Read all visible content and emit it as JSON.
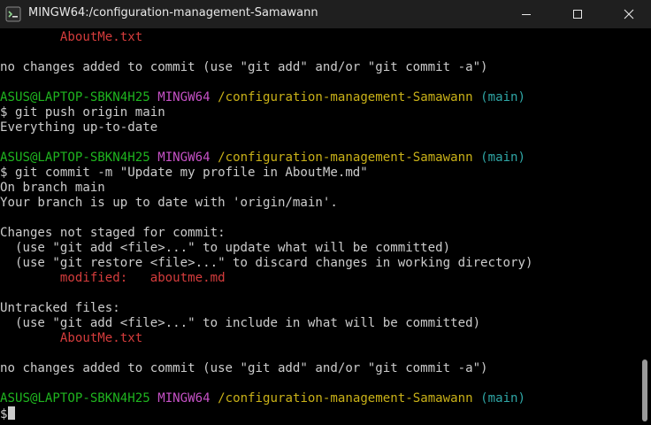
{
  "window": {
    "title": "MINGW64:/configuration-management-Samawann",
    "controls": {
      "minimize_icon": "minimize-icon",
      "maximize_icon": "maximize-icon",
      "close_icon": "close-icon"
    }
  },
  "terminal": {
    "prompt": {
      "user_host": "ASUS@LAPTOP-SBKN4H25",
      "shell": "MINGW64",
      "path": "/configuration-management-Samawann",
      "branch": "(main)",
      "symbol": "$"
    },
    "lines": {
      "l01": "        AboutMe.txt",
      "l03": "no changes added to commit (use \"git add\" and/or \"git commit -a\")",
      "l06": "$ git push origin main",
      "l07": "Everything up-to-date",
      "l10": "$ git commit -m \"Update my profile in AboutMe.md\"",
      "l11": "On branch main",
      "l12": "Your branch is up to date with 'origin/main'.",
      "l14": "Changes not staged for commit:",
      "l15": "  (use \"git add <file>...\" to update what will be committed)",
      "l16": "  (use \"git restore <file>...\" to discard changes in working directory)",
      "l17": "        modified:   aboutme.md",
      "l19": "Untracked files:",
      "l20": "  (use \"git add <file>...\" to include in what will be committed)",
      "l21": "        AboutMe.txt",
      "l23": "no changes added to commit (use \"git add\" and/or \"git commit -a\")",
      "l26": "$"
    }
  },
  "colors": {
    "background": "#000000",
    "text": "#cccccc",
    "red": "#d43c3c",
    "green": "#1fb51f",
    "magenta": "#c651c6",
    "yellow": "#c9b118",
    "cyan": "#2fa6a6",
    "titlebar": "#1f1f1f"
  }
}
